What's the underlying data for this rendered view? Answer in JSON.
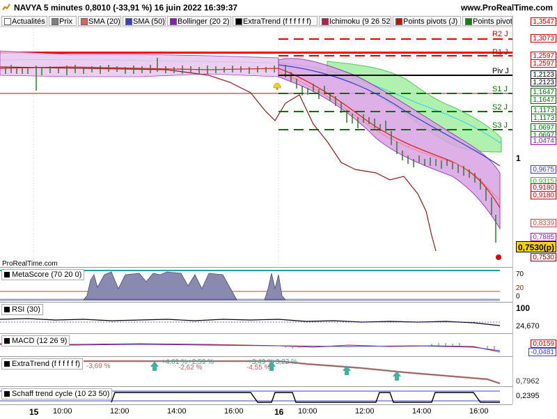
{
  "header": {
    "title": "NAVYA 5 minutes 0,8010 (-33,91 %) 16 juin 2022 16:39:37",
    "site": "www.ProRealTime.com"
  },
  "legend": [
    {
      "label": "Actualités",
      "color": "#ffffff"
    },
    {
      "label": "Prix",
      "color": "#808080"
    },
    {
      "label": "SMA (20)",
      "color": "#e0605c"
    },
    {
      "label": "SMA (50)",
      "color": "#3a3ad8"
    },
    {
      "label": "Bollinger (20 2)",
      "color": "#8c1fb0"
    },
    {
      "label": "ExtraTrend (f f f f f f)",
      "color": "#000000"
    },
    {
      "label": "Ichimoku (9 26 52)",
      "color": "#d0104f"
    },
    {
      "label": "Points pivots (J)",
      "color": "#c01010"
    },
    {
      "label": "Points pivot",
      "color": "#108010"
    }
  ],
  "pivots": [
    {
      "label": "R2 J",
      "color": "#e00000"
    },
    {
      "label": "R1 J",
      "color": "#e00000"
    },
    {
      "label": "Piv J",
      "color": "#000000"
    },
    {
      "label": "S1 J",
      "color": "#007000"
    },
    {
      "label": "S2 J",
      "color": "#007000"
    },
    {
      "label": "S3 J",
      "color": "#007000"
    }
  ],
  "price_axis": {
    "labels": [
      {
        "text": "1,3547",
        "color": "#d00000"
      },
      {
        "text": "1,3073",
        "color": "#d00000"
      },
      {
        "text": "1,2597",
        "color": "#d00000"
      },
      {
        "text": "1,2597",
        "color": "#d00000"
      },
      {
        "text": "1,2123",
        "color": "#000000"
      },
      {
        "text": "1,2123",
        "color": "#000000"
      },
      {
        "text": "1,1647",
        "color": "#007000"
      },
      {
        "text": "1,1647",
        "color": "#007000"
      },
      {
        "text": "1,1173",
        "color": "#007000"
      },
      {
        "text": "1,1173",
        "color": "#007000"
      },
      {
        "text": "1,0697",
        "color": "#007000"
      },
      {
        "text": "1,0697",
        "color": "#007000"
      },
      {
        "text": "1,0474",
        "color": "#8c1fb0"
      },
      {
        "text": "1",
        "color": "#000000"
      },
      {
        "text": "0,9675",
        "color": "#3a3ad8"
      },
      {
        "text": "0,9315",
        "color": "#3ab53a"
      },
      {
        "text": "0,9180",
        "color": "#d00000"
      },
      {
        "text": "0,9180",
        "color": "#d00000"
      },
      {
        "text": "0,8339",
        "color": "#c05050"
      },
      {
        "text": "0,7885",
        "color": "#8c1fb0"
      },
      {
        "text": "0,7530(p)",
        "color": "#000000"
      },
      {
        "text": "0,7530",
        "color": "#8b0000"
      }
    ],
    "current": "0,7530(p)"
  },
  "watermark": "ProRealTime.com",
  "panes": [
    {
      "name": "MetaScore (70 20 0)",
      "values": [
        "70",
        "20",
        "0"
      ]
    },
    {
      "name": "RSI (30)",
      "values": [
        "100",
        "24,670"
      ]
    },
    {
      "name": "MACD (12 26 9)",
      "values": [
        "0,0159",
        "-0,0481"
      ]
    },
    {
      "name": "ExtraTrend (f f f f f f)",
      "values": [
        "0,7962"
      ],
      "annotations": [
        "-3,69 %",
        "+4,01 %",
        "+2,59 %",
        "-2,62 %",
        "+3,49 %",
        "+3,22 %",
        "-4,55 %"
      ]
    },
    {
      "name": "Schaff trend cycle (10 23 50)",
      "values": [
        "0,2395"
      ]
    }
  ],
  "xaxis": {
    "labels": [
      {
        "text": "15",
        "big": true
      },
      {
        "text": "10:00",
        "big": false
      },
      {
        "text": "12:00",
        "big": false
      },
      {
        "text": "14:00",
        "big": false
      },
      {
        "text": "16:00",
        "big": false
      },
      {
        "text": "16",
        "big": true
      },
      {
        "text": "10:00",
        "big": false
      },
      {
        "text": "12:00",
        "big": false
      },
      {
        "text": "14:00",
        "big": false
      },
      {
        "text": "16:00",
        "big": false
      }
    ]
  }
}
